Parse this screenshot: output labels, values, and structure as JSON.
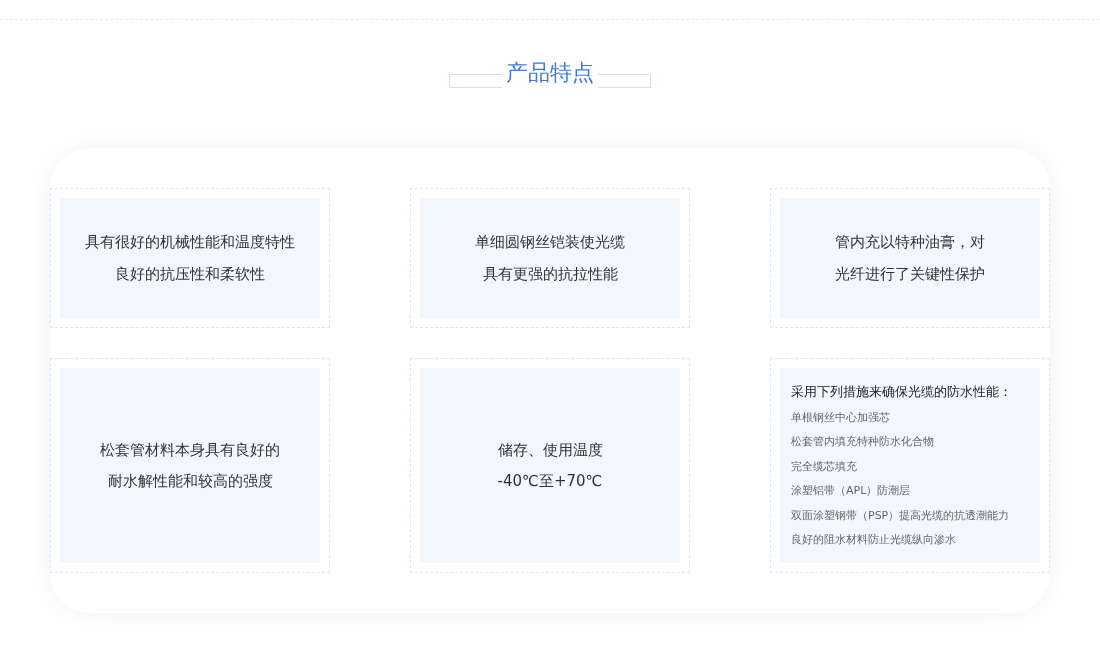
{
  "section_title": "产品特点",
  "cards": [
    {
      "kind": "text",
      "lines": [
        "具有很好的机械性能和温度特性",
        "良好的抗压性和柔软性"
      ]
    },
    {
      "kind": "text",
      "lines": [
        "单细圆钢丝铠装使光缆",
        "具有更强的抗拉性能"
      ]
    },
    {
      "kind": "text",
      "lines": [
        "管内充以特种油膏，对",
        "光纤进行了关键性保护"
      ]
    },
    {
      "kind": "text",
      "lines": [
        "松套管材料本身具有良好的",
        "耐水解性能和较高的强度"
      ]
    },
    {
      "kind": "text",
      "lines": [
        "储存、使用温度",
        "-40℃至+70℃"
      ]
    },
    {
      "kind": "list",
      "heading": "采用下列措施来确保光缆的防水性能：",
      "items": [
        "单根钢丝中心加强芯",
        "松套管内填充特种防水化合物",
        "完全缆芯填充",
        "涂塑铝带（APL）防潮层",
        "双面涂塑钢带（PSP）提高光缆的抗透潮能力",
        "良好的阻水材料防止光缆纵向渗水"
      ]
    }
  ]
}
